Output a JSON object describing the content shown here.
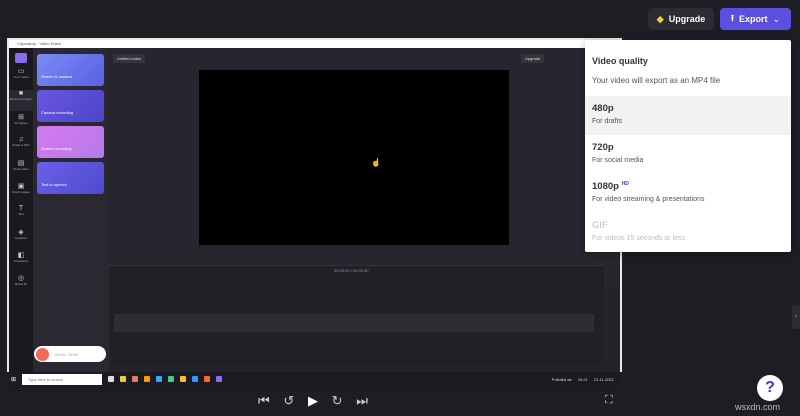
{
  "header": {
    "upgrade_label": "Upgrade",
    "export_label": "Export"
  },
  "embedded": {
    "window_title": "Clipchamp - Video Editor",
    "project_title": "Untitled video",
    "upgrade": "Upgrade",
    "sidebar": [
      "Your media",
      "Record & create",
      "Templates",
      "Music & SFX",
      "Stock video",
      "Stock images",
      "Text",
      "Graphics",
      "Transitions",
      "Brand kit"
    ],
    "cards": [
      "Screen & camera",
      "Camera recording",
      "Screen recording",
      "Text to speech"
    ],
    "timecode": "00:00.00 / 00:00.00",
    "rec_time": "00:00 / 30:00",
    "taskbar_search": "Type here to search",
    "weather": "Polluted air",
    "clock_time": "19:21",
    "clock_date": "21-11-2021"
  },
  "export_menu": {
    "title": "Video quality",
    "subtitle": "Your video will export as an MP4 file",
    "options": [
      {
        "label": "480p",
        "desc": "For drafts"
      },
      {
        "label": "720p",
        "desc": "For social media"
      },
      {
        "label": "1080p",
        "badge": "HD",
        "desc": "For video streaming & presentations"
      },
      {
        "label": "GIF",
        "desc": "For videos 15 seconds or less"
      }
    ]
  },
  "help_label": "?",
  "watermark": "wsxdn.com"
}
